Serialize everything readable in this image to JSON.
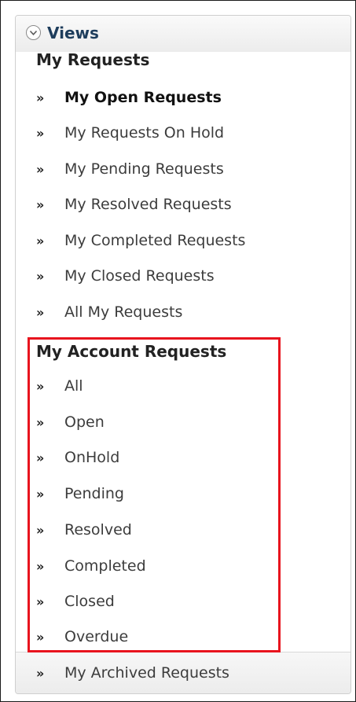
{
  "header": {
    "title": "Views",
    "toggle_icon": "chevron-down-circle-icon"
  },
  "my_requests": {
    "title": "My Requests",
    "items": [
      {
        "label": "My Open Requests",
        "active": true
      },
      {
        "label": "My Requests On Hold",
        "active": false
      },
      {
        "label": "My Pending Requests",
        "active": false
      },
      {
        "label": "My Resolved Requests",
        "active": false
      },
      {
        "label": "My Completed Requests",
        "active": false
      },
      {
        "label": "My Closed Requests",
        "active": false
      },
      {
        "label": "All My Requests",
        "active": false
      }
    ]
  },
  "account_requests": {
    "title": "My Account Requests",
    "items": [
      {
        "label": "All"
      },
      {
        "label": "Open"
      },
      {
        "label": "OnHold"
      },
      {
        "label": "Pending"
      },
      {
        "label": "Resolved"
      },
      {
        "label": "Completed"
      },
      {
        "label": "Closed"
      },
      {
        "label": "Overdue"
      }
    ]
  },
  "footer": {
    "label": "My Archived Requests"
  },
  "bullet_glyph": "»",
  "colors": {
    "highlight_border": "#e8141e",
    "header_text": "#1e3d5c"
  }
}
